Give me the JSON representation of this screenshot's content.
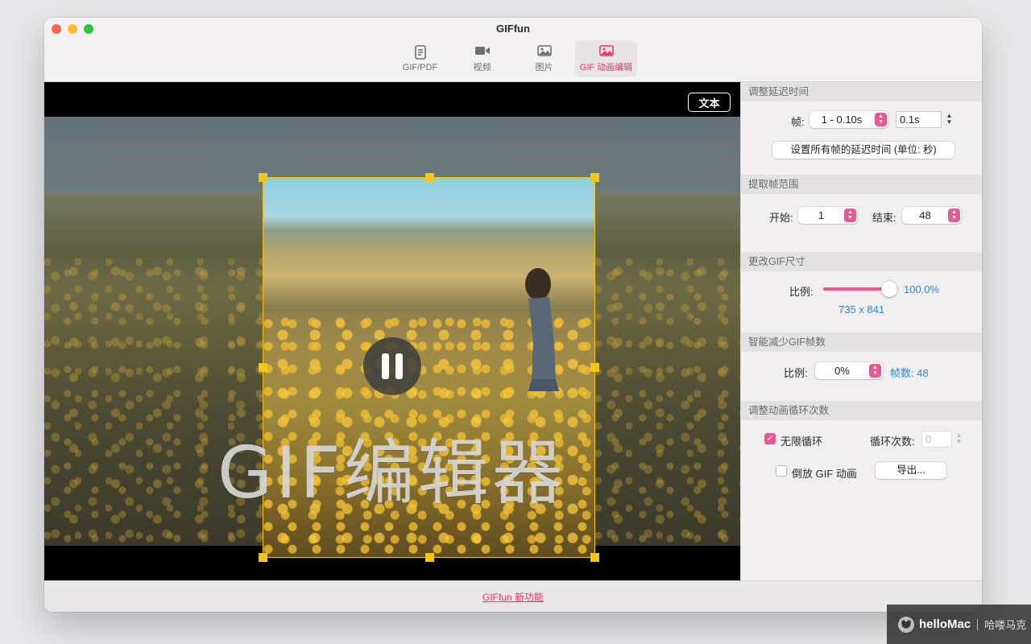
{
  "window": {
    "title": "GIFfun"
  },
  "toolbar": {
    "tabs": [
      {
        "label": "GIF/PDF",
        "icon": "document-icon",
        "active": false
      },
      {
        "label": "视频",
        "icon": "video-camera-icon",
        "active": false
      },
      {
        "label": "图片",
        "icon": "image-icon",
        "active": false
      },
      {
        "label": "GIF 动画编辑",
        "icon": "image-edit-icon",
        "active": true
      }
    ]
  },
  "canvas": {
    "text_button": "文本",
    "overlay_text": "GIF编辑器",
    "playback_state": "playing"
  },
  "panel": {
    "delay": {
      "header": "调整延迟时间",
      "frame_label": "帧:",
      "frame_value": "1 - 0.10s",
      "delay_value": "0.1s",
      "set_all_button": "设置所有帧的延迟时间 (单位: 秒)"
    },
    "range": {
      "header": "提取帧范围",
      "start_label": "开始:",
      "start_value": "1",
      "end_label": "结束:",
      "end_value": "48"
    },
    "size": {
      "header": "更改GIF尺寸",
      "scale_label": "比例:",
      "scale_percent": "100.0%",
      "scale_fraction": 1.0,
      "dimensions": "735 x 841"
    },
    "reduce": {
      "header": "智能减少GIF帧数",
      "ratio_label": "比例:",
      "ratio_value": "0%",
      "frame_count": "帧数: 48"
    },
    "loop": {
      "header": "调整动画循环次数",
      "infinite_label": "无限循环",
      "infinite_checked": true,
      "count_label": "循环次数:",
      "count_placeholder": "0",
      "reverse_label": "倒放 GIF 动画",
      "reverse_checked": false,
      "export_button": "导出..."
    }
  },
  "status": {
    "link": "GIFfun 新功能"
  },
  "watermark": {
    "brand": "helloMac",
    "cn": "哈喽马克"
  },
  "colors": {
    "accent": "#e65a91",
    "link": "#e8336e",
    "blue": "#2c86d6",
    "crop": "#f5c518"
  }
}
